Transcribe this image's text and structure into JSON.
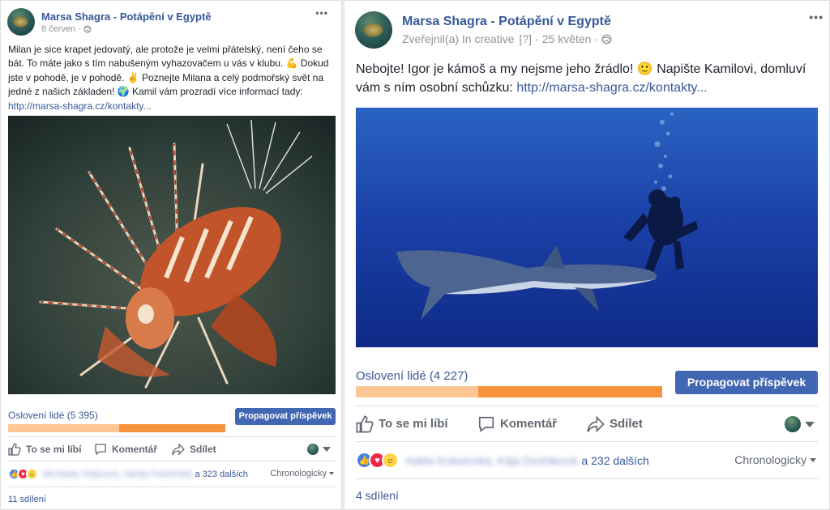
{
  "post_left": {
    "page_name": "Marsa Shagra - Potápění v Egyptě",
    "date": "8 červen",
    "more_icon": "•••",
    "text": "Milan je sice krapet jedovatý, ale protože je velmi přátelský, není čeho se bát. To máte jako s tím nabušeným vyhazovačem u vás v klubu. 💪 Dokud jste v pohodě, je v pohodě. ✌ Poznejte Milana a celý podmořský svět na jedné z našich základen! 🌍 Kamil vám prozradí více informací tady: ",
    "link": "http://marsa-shagra.cz/kontakty...",
    "reach_label": "Oslovení lidé (5 395)",
    "reach_fill_fraction": 0.51,
    "promote_label": "Propagovat příspěvek",
    "like_label": "To se mi líbí",
    "comment_label": "Komentář",
    "share_label": "Sdílet",
    "reactors_blurred": "Michaela Vrabcová, Vanda Pavlovská",
    "others": "a 323 dalších",
    "sort_label": "Chronologicky",
    "shares": "11 sdílení"
  },
  "post_right": {
    "page_name": "Marsa Shagra - Potápění v Egyptě",
    "published": "Zveřejnil(a) In creative",
    "bracket": "[?]",
    "date": "25 květen",
    "more_icon": "•••",
    "text": "Nebojte! Igor je kámoš a my nejsme jeho žrádlo! 🙂 Napište Kamilovi, domluví vám s ním osobní schůzku: ",
    "link": "http://marsa-shagra.cz/kontakty...",
    "reach_label": "Oslovení lidé (4 227)",
    "reach_fill_fraction": 0.4,
    "promote_label": "Propagovat příspěvek",
    "like_label": "To se mi líbí",
    "comment_label": "Komentář",
    "share_label": "Sdílet",
    "reactors_blurred": "Adéla Krásenská, Kája Dvořáková",
    "others": "a 232 dalších",
    "sort_label": "Chronologicky",
    "shares": "4 sdílení"
  },
  "colors": {
    "link": "#365899",
    "bar_light": "#fcc795",
    "bar_dark": "#f7933b",
    "promote_bg": "#4267b2"
  },
  "icons": [
    "like-icon",
    "comment-icon",
    "share-icon",
    "globe-icon",
    "like-reaction-icon",
    "love-reaction-icon",
    "wow-reaction-icon",
    "more-icon"
  ]
}
